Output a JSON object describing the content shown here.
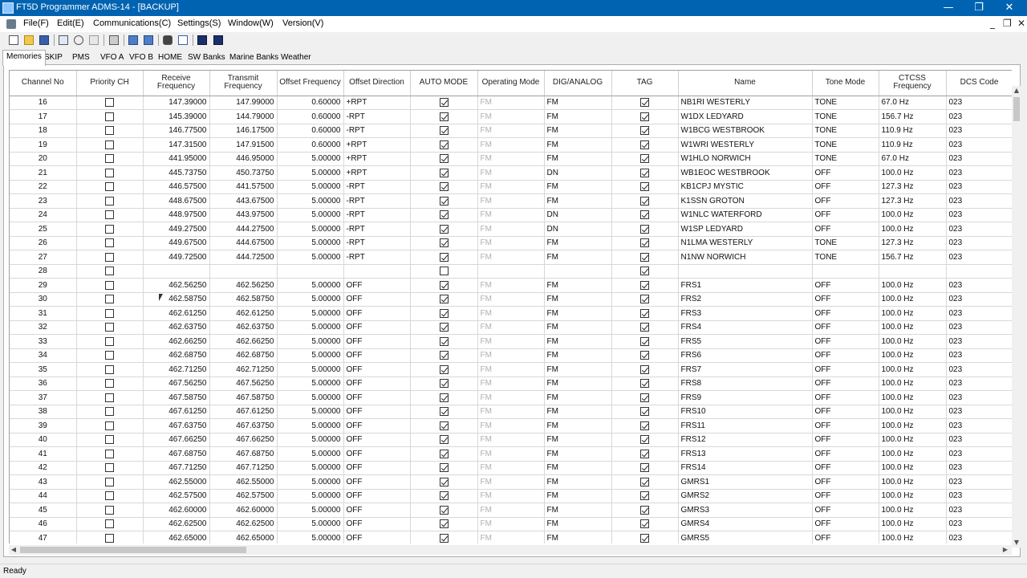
{
  "window": {
    "title": "FT5D Programmer ADMS-14 - [BACKUP]",
    "minimize_glyph": "—",
    "maximize_glyph": "❐",
    "close_glyph": "✕"
  },
  "menu": {
    "items": [
      "File(F)",
      "Edit(E)",
      "Communications(C)",
      "Settings(S)",
      "Window(W)",
      "Version(V)"
    ],
    "mdi_minimize": "_",
    "mdi_restore": "❐",
    "mdi_close": "✕"
  },
  "toolbar": {
    "icons": [
      "new-file-icon",
      "open-folder-icon",
      "save-icon",
      "copy-icon",
      "cut-icon",
      "paste-icon",
      "print-icon",
      "import-icon",
      "export-icon",
      "binoculars-icon",
      "sort-icon",
      "read-radio-icon",
      "write-radio-icon"
    ]
  },
  "tabs": [
    "Memories",
    "SKIP",
    "PMS",
    "VFO A",
    "VFO B",
    "HOME",
    "SW Banks",
    "Marine Banks",
    "Weather"
  ],
  "active_tab": "Memories",
  "columns": [
    "Channel No",
    "Priority CH",
    "Receive Frequency",
    "Transmit Frequency",
    "Offset Frequency",
    "Offset Direction",
    "AUTO MODE",
    "Operating Mode",
    "DIG/ANALOG",
    "TAG",
    "Name",
    "Tone Mode",
    "CTCSS Frequency",
    "DCS Code"
  ],
  "rows": [
    {
      "ch": "16",
      "rx": "147.39000",
      "tx": "147.99000",
      "off": "0.60000",
      "dir": "+RPT",
      "auto": true,
      "op": "FM",
      "dig": "FM",
      "tag": true,
      "name": "NB1RI WESTERLY",
      "tone": "TONE",
      "ctcss": "67.0 Hz",
      "dcs": "023"
    },
    {
      "ch": "17",
      "rx": "145.39000",
      "tx": "144.79000",
      "off": "0.60000",
      "dir": "-RPT",
      "auto": true,
      "op": "FM",
      "dig": "FM",
      "tag": true,
      "name": "W1DX LEDYARD",
      "tone": "TONE",
      "ctcss": "156.7 Hz",
      "dcs": "023"
    },
    {
      "ch": "18",
      "rx": "146.77500",
      "tx": "146.17500",
      "off": "0.60000",
      "dir": "-RPT",
      "auto": true,
      "op": "FM",
      "dig": "FM",
      "tag": true,
      "name": "W1BCG WESTBROOK",
      "tone": "TONE",
      "ctcss": "110.9 Hz",
      "dcs": "023"
    },
    {
      "ch": "19",
      "rx": "147.31500",
      "tx": "147.91500",
      "off": "0.60000",
      "dir": "+RPT",
      "auto": true,
      "op": "FM",
      "dig": "FM",
      "tag": true,
      "name": "W1WRI WESTERLY",
      "tone": "TONE",
      "ctcss": "110.9 Hz",
      "dcs": "023"
    },
    {
      "ch": "20",
      "rx": "441.95000",
      "tx": "446.95000",
      "off": "5.00000",
      "dir": "+RPT",
      "auto": true,
      "op": "FM",
      "dig": "FM",
      "tag": true,
      "name": "W1HLO NORWICH",
      "tone": "TONE",
      "ctcss": "67.0 Hz",
      "dcs": "023"
    },
    {
      "ch": "21",
      "rx": "445.73750",
      "tx": "450.73750",
      "off": "5.00000",
      "dir": "+RPT",
      "auto": true,
      "op": "FM",
      "dig": "DN",
      "tag": true,
      "name": "WB1EOC WESTBROOK",
      "tone": "OFF",
      "ctcss": "100.0 Hz",
      "dcs": "023"
    },
    {
      "ch": "22",
      "rx": "446.57500",
      "tx": "441.57500",
      "off": "5.00000",
      "dir": "-RPT",
      "auto": true,
      "op": "FM",
      "dig": "FM",
      "tag": true,
      "name": "KB1CPJ MYSTIC",
      "tone": "OFF",
      "ctcss": "127.3 Hz",
      "dcs": "023"
    },
    {
      "ch": "23",
      "rx": "448.67500",
      "tx": "443.67500",
      "off": "5.00000",
      "dir": "-RPT",
      "auto": true,
      "op": "FM",
      "dig": "FM",
      "tag": true,
      "name": "K1SSN GROTON",
      "tone": "OFF",
      "ctcss": "127.3 Hz",
      "dcs": "023"
    },
    {
      "ch": "24",
      "rx": "448.97500",
      "tx": "443.97500",
      "off": "5.00000",
      "dir": "-RPT",
      "auto": true,
      "op": "FM",
      "dig": "DN",
      "tag": true,
      "name": "W1NLC WATERFORD",
      "tone": "OFF",
      "ctcss": "100.0 Hz",
      "dcs": "023"
    },
    {
      "ch": "25",
      "rx": "449.27500",
      "tx": "444.27500",
      "off": "5.00000",
      "dir": "-RPT",
      "auto": true,
      "op": "FM",
      "dig": "DN",
      "tag": true,
      "name": "W1SP LEDYARD",
      "tone": "OFF",
      "ctcss": "100.0 Hz",
      "dcs": "023"
    },
    {
      "ch": "26",
      "rx": "449.67500",
      "tx": "444.67500",
      "off": "5.00000",
      "dir": "-RPT",
      "auto": true,
      "op": "FM",
      "dig": "FM",
      "tag": true,
      "name": "N1LMA WESTERLY",
      "tone": "TONE",
      "ctcss": "127.3 Hz",
      "dcs": "023"
    },
    {
      "ch": "27",
      "rx": "449.72500",
      "tx": "444.72500",
      "off": "5.00000",
      "dir": "-RPT",
      "auto": true,
      "op": "FM",
      "dig": "FM",
      "tag": true,
      "name": "N1NW NORWICH",
      "tone": "TONE",
      "ctcss": "156.7 Hz",
      "dcs": "023"
    },
    {
      "ch": "28",
      "rx": "",
      "tx": "",
      "off": "",
      "dir": "",
      "auto": false,
      "op": "",
      "dig": "",
      "tag": true,
      "name": "",
      "tone": "",
      "ctcss": "",
      "dcs": ""
    },
    {
      "ch": "29",
      "rx": "462.56250",
      "tx": "462.56250",
      "off": "5.00000",
      "dir": "OFF",
      "auto": true,
      "op": "FM",
      "dig": "FM",
      "tag": true,
      "name": "FRS1",
      "tone": "OFF",
      "ctcss": "100.0 Hz",
      "dcs": "023"
    },
    {
      "ch": "30",
      "rx": "462.58750",
      "tx": "462.58750",
      "off": "5.00000",
      "dir": "OFF",
      "auto": true,
      "op": "FM",
      "dig": "FM",
      "tag": true,
      "name": "FRS2",
      "tone": "OFF",
      "ctcss": "100.0 Hz",
      "dcs": "023"
    },
    {
      "ch": "31",
      "rx": "462.61250",
      "tx": "462.61250",
      "off": "5.00000",
      "dir": "OFF",
      "auto": true,
      "op": "FM",
      "dig": "FM",
      "tag": true,
      "name": "FRS3",
      "tone": "OFF",
      "ctcss": "100.0 Hz",
      "dcs": "023"
    },
    {
      "ch": "32",
      "rx": "462.63750",
      "tx": "462.63750",
      "off": "5.00000",
      "dir": "OFF",
      "auto": true,
      "op": "FM",
      "dig": "FM",
      "tag": true,
      "name": "FRS4",
      "tone": "OFF",
      "ctcss": "100.0 Hz",
      "dcs": "023"
    },
    {
      "ch": "33",
      "rx": "462.66250",
      "tx": "462.66250",
      "off": "5.00000",
      "dir": "OFF",
      "auto": true,
      "op": "FM",
      "dig": "FM",
      "tag": true,
      "name": "FRS5",
      "tone": "OFF",
      "ctcss": "100.0 Hz",
      "dcs": "023"
    },
    {
      "ch": "34",
      "rx": "462.68750",
      "tx": "462.68750",
      "off": "5.00000",
      "dir": "OFF",
      "auto": true,
      "op": "FM",
      "dig": "FM",
      "tag": true,
      "name": "FRS6",
      "tone": "OFF",
      "ctcss": "100.0 Hz",
      "dcs": "023"
    },
    {
      "ch": "35",
      "rx": "462.71250",
      "tx": "462.71250",
      "off": "5.00000",
      "dir": "OFF",
      "auto": true,
      "op": "FM",
      "dig": "FM",
      "tag": true,
      "name": "FRS7",
      "tone": "OFF",
      "ctcss": "100.0 Hz",
      "dcs": "023"
    },
    {
      "ch": "36",
      "rx": "467.56250",
      "tx": "467.56250",
      "off": "5.00000",
      "dir": "OFF",
      "auto": true,
      "op": "FM",
      "dig": "FM",
      "tag": true,
      "name": "FRS8",
      "tone": "OFF",
      "ctcss": "100.0 Hz",
      "dcs": "023"
    },
    {
      "ch": "37",
      "rx": "467.58750",
      "tx": "467.58750",
      "off": "5.00000",
      "dir": "OFF",
      "auto": true,
      "op": "FM",
      "dig": "FM",
      "tag": true,
      "name": "FRS9",
      "tone": "OFF",
      "ctcss": "100.0 Hz",
      "dcs": "023"
    },
    {
      "ch": "38",
      "rx": "467.61250",
      "tx": "467.61250",
      "off": "5.00000",
      "dir": "OFF",
      "auto": true,
      "op": "FM",
      "dig": "FM",
      "tag": true,
      "name": "FRS10",
      "tone": "OFF",
      "ctcss": "100.0 Hz",
      "dcs": "023"
    },
    {
      "ch": "39",
      "rx": "467.63750",
      "tx": "467.63750",
      "off": "5.00000",
      "dir": "OFF",
      "auto": true,
      "op": "FM",
      "dig": "FM",
      "tag": true,
      "name": "FRS11",
      "tone": "OFF",
      "ctcss": "100.0 Hz",
      "dcs": "023"
    },
    {
      "ch": "40",
      "rx": "467.66250",
      "tx": "467.66250",
      "off": "5.00000",
      "dir": "OFF",
      "auto": true,
      "op": "FM",
      "dig": "FM",
      "tag": true,
      "name": "FRS12",
      "tone": "OFF",
      "ctcss": "100.0 Hz",
      "dcs": "023"
    },
    {
      "ch": "41",
      "rx": "467.68750",
      "tx": "467.68750",
      "off": "5.00000",
      "dir": "OFF",
      "auto": true,
      "op": "FM",
      "dig": "FM",
      "tag": true,
      "name": "FRS13",
      "tone": "OFF",
      "ctcss": "100.0 Hz",
      "dcs": "023"
    },
    {
      "ch": "42",
      "rx": "467.71250",
      "tx": "467.71250",
      "off": "5.00000",
      "dir": "OFF",
      "auto": true,
      "op": "FM",
      "dig": "FM",
      "tag": true,
      "name": "FRS14",
      "tone": "OFF",
      "ctcss": "100.0 Hz",
      "dcs": "023"
    },
    {
      "ch": "43",
      "rx": "462.55000",
      "tx": "462.55000",
      "off": "5.00000",
      "dir": "OFF",
      "auto": true,
      "op": "FM",
      "dig": "FM",
      "tag": true,
      "name": "GMRS1",
      "tone": "OFF",
      "ctcss": "100.0 Hz",
      "dcs": "023"
    },
    {
      "ch": "44",
      "rx": "462.57500",
      "tx": "462.57500",
      "off": "5.00000",
      "dir": "OFF",
      "auto": true,
      "op": "FM",
      "dig": "FM",
      "tag": true,
      "name": "GMRS2",
      "tone": "OFF",
      "ctcss": "100.0 Hz",
      "dcs": "023"
    },
    {
      "ch": "45",
      "rx": "462.60000",
      "tx": "462.60000",
      "off": "5.00000",
      "dir": "OFF",
      "auto": true,
      "op": "FM",
      "dig": "FM",
      "tag": true,
      "name": "GMRS3",
      "tone": "OFF",
      "ctcss": "100.0 Hz",
      "dcs": "023"
    },
    {
      "ch": "46",
      "rx": "462.62500",
      "tx": "462.62500",
      "off": "5.00000",
      "dir": "OFF",
      "auto": true,
      "op": "FM",
      "dig": "FM",
      "tag": true,
      "name": "GMRS4",
      "tone": "OFF",
      "ctcss": "100.0 Hz",
      "dcs": "023"
    },
    {
      "ch": "47",
      "rx": "462.65000",
      "tx": "462.65000",
      "off": "5.00000",
      "dir": "OFF",
      "auto": true,
      "op": "FM",
      "dig": "FM",
      "tag": true,
      "name": "GMRS5",
      "tone": "OFF",
      "ctcss": "100.0 Hz",
      "dcs": "023"
    }
  ],
  "scroll": {
    "up": "▲",
    "down": "▼",
    "left": "◀",
    "right": "▶"
  },
  "status": {
    "text": "Ready"
  },
  "colors": {
    "titlebar": "#0063b1",
    "disabled_text": "#b0b0b0"
  }
}
